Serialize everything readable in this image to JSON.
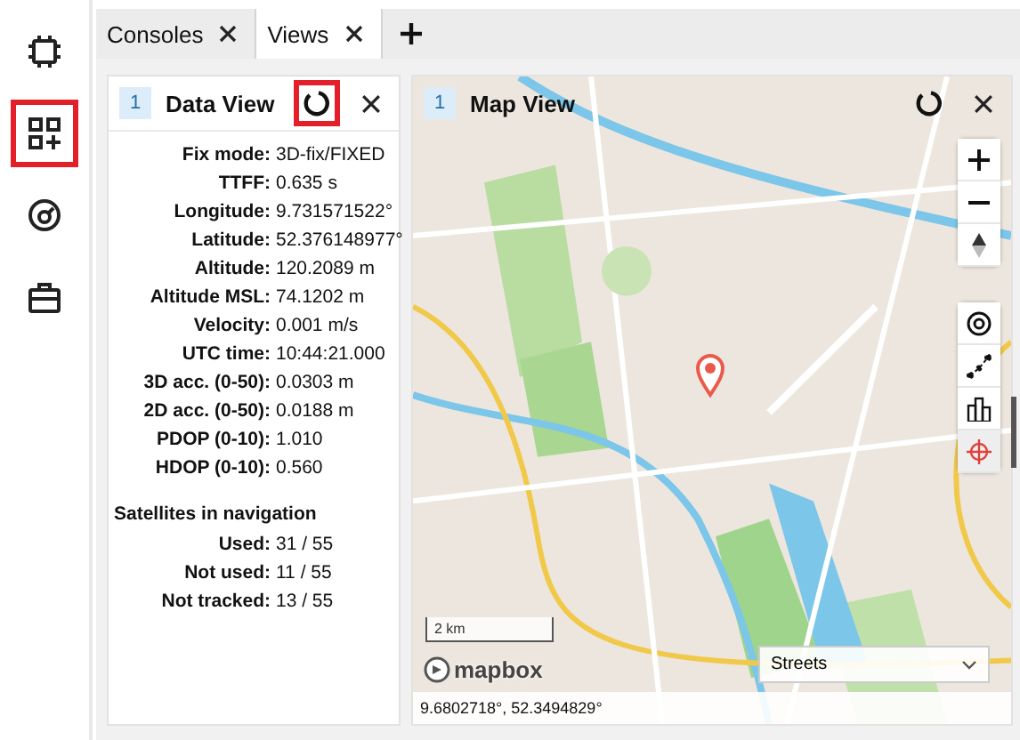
{
  "sidebar": {
    "items": [
      {
        "kind": "chip",
        "highlighted": false
      },
      {
        "kind": "add-widget",
        "highlighted": true
      },
      {
        "kind": "gauge",
        "highlighted": false
      },
      {
        "kind": "toolbox",
        "highlighted": false
      }
    ]
  },
  "tabs": [
    {
      "label": "Consoles",
      "selected": false
    },
    {
      "label": "Views",
      "selected": true
    }
  ],
  "data_view": {
    "index": "1",
    "title": "Data View",
    "refresh_highlighted": true,
    "fields": [
      {
        "label": "Fix mode:",
        "value": "3D-fix/FIXED"
      },
      {
        "label": "TTFF:",
        "value": "0.635 s"
      },
      {
        "label": "Longitude:",
        "value": "9.731571522°"
      },
      {
        "label": "Latitude:",
        "value": "52.376148977°"
      },
      {
        "label": "Altitude:",
        "value": "120.2089 m"
      },
      {
        "label": "Altitude MSL:",
        "value": "74.1202 m"
      },
      {
        "label": "Velocity:",
        "value": "0.001 m/s"
      },
      {
        "label": "UTC time:",
        "value": "10:44:21.000"
      },
      {
        "label": "3D acc. (0-50):",
        "value": "0.0303 m"
      },
      {
        "label": "2D acc. (0-50):",
        "value": "0.0188 m"
      },
      {
        "label": "PDOP (0-10):",
        "value": "1.010"
      },
      {
        "label": "HDOP (0-10):",
        "value": "0.560"
      }
    ],
    "section": "Satellites in navigation",
    "satellites": [
      {
        "label": "Used:",
        "value": "31 / 55"
      },
      {
        "label": "Not used:",
        "value": "11 / 55"
      },
      {
        "label": "Not tracked:",
        "value": "13 / 55"
      }
    ]
  },
  "map_view": {
    "index": "1",
    "title": "Map View",
    "refresh_highlighted": false,
    "scale": "2 km",
    "attribution": "mapbox",
    "style": "Streets",
    "coordinates": "9.6802718°, 52.3494829°"
  }
}
